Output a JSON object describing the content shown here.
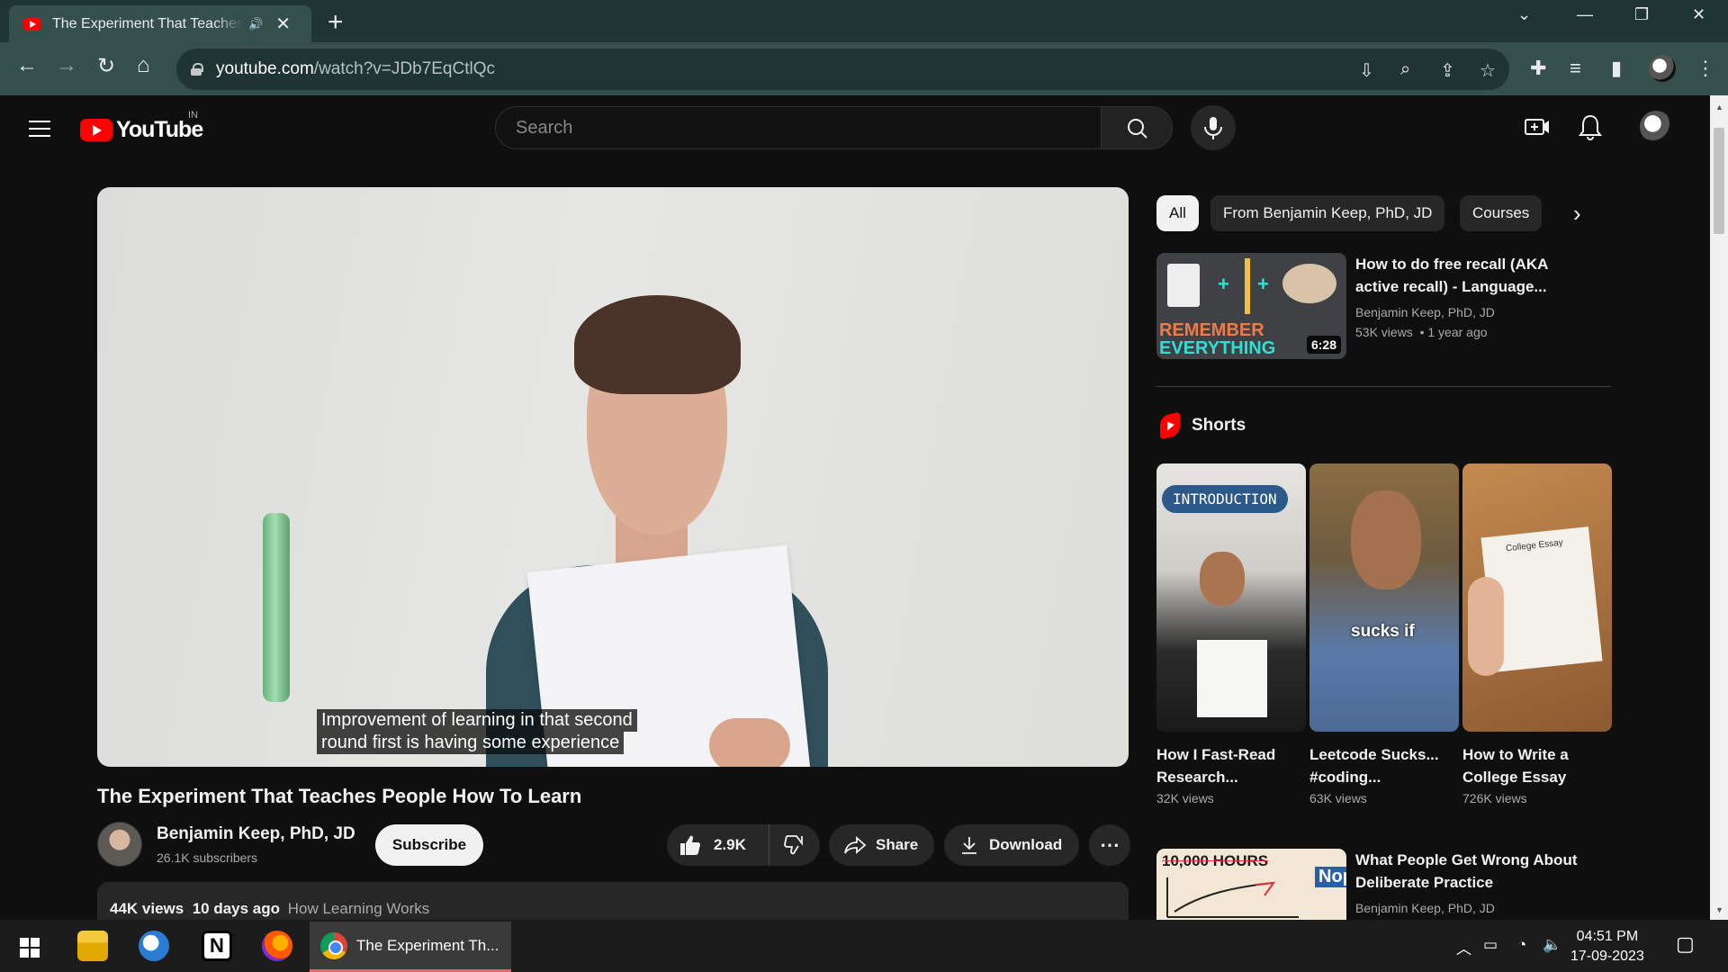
{
  "browser": {
    "tab_title": "The Experiment That Teaches People How To Learn",
    "url_host": "youtube.com",
    "url_path": "/watch?v=JDb7EqCtlQc"
  },
  "youtube": {
    "logo_text": "YouTube",
    "country_code": "IN",
    "search_placeholder": "Search"
  },
  "video": {
    "caption_line1": "Improvement of learning in that second",
    "caption_line2": "round first is having some experience",
    "title": "The Experiment That Teaches People How To Learn",
    "channel_name": "Benjamin Keep, PhD, JD",
    "subscribers": "26.1K subscribers",
    "subscribe_label": "Subscribe",
    "likes": "2.9K",
    "share_label": "Share",
    "download_label": "Download",
    "views": "44K views",
    "age": "10 days ago",
    "tag": "How Learning Works"
  },
  "chips": [
    "All",
    "From Benjamin Keep, PhD, JD",
    "Courses"
  ],
  "recommendations": [
    {
      "title_line1": "How to do free recall (AKA",
      "title_line2": "active recall) - Language...",
      "channel": "Benjamin Keep, PhD, JD",
      "meta": "53K views  • 1 year ago",
      "duration": "6:28",
      "thumb_text1": "REMEMBER",
      "thumb_text2": "EVERYTHING"
    },
    {
      "title_line1": "What People Get Wrong About",
      "title_line2": "Deliberate Practice",
      "channel": "Benjamin Keep, PhD, JD",
      "thumb_text1": "10,000 HOURS",
      "thumb_text2": "Nope."
    }
  ],
  "shorts": {
    "label": "Shorts",
    "items": [
      {
        "title_line1": "How I Fast-Read",
        "title_line2": "Research...",
        "views": "32K views",
        "overlay": "INTRODUCTION"
      },
      {
        "title_line1": "Leetcode Sucks...",
        "title_line2": "#coding...",
        "views": "63K views",
        "overlay": "sucks if"
      },
      {
        "title_line1": "How to Write a",
        "title_line2": "College Essay",
        "views": "726K views",
        "overlay": "College Essay"
      }
    ]
  },
  "taskbar": {
    "active_app": "The Experiment Th...",
    "time": "04:51 PM",
    "date": "17-09-2023"
  },
  "colors": {
    "yt_red": "#ff0000",
    "chrome_frame": "#1f3533",
    "chrome_toolbar": "#35504c",
    "yt_bg": "#0f0f0f"
  }
}
